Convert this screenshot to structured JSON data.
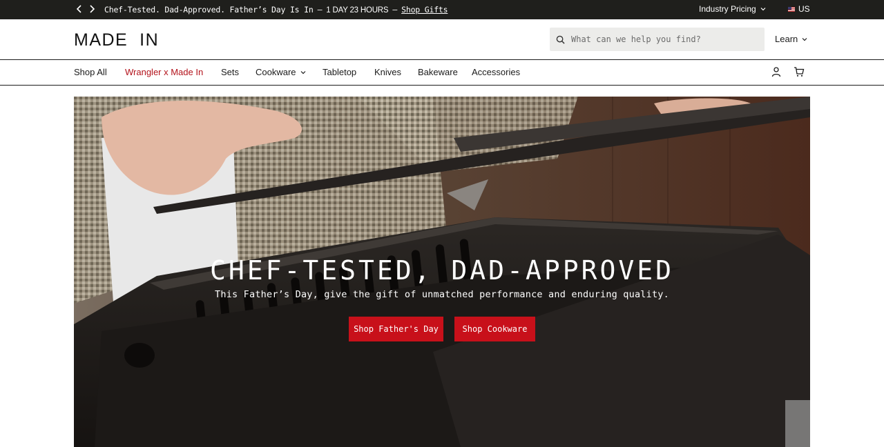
{
  "announcement": {
    "message": "Chef-Tested. Dad-Approved. Father’s Day Is In",
    "separator": "—",
    "countdown": "1 DAY 23 HOURS",
    "link_label": "Shop Gifts",
    "industry_pricing": "Industry Pricing",
    "locale": "US",
    "prev_icon": "chevron-left-icon",
    "next_icon": "chevron-right-icon"
  },
  "header": {
    "logo": "MADE  IN",
    "search_placeholder": "What can we help you find?",
    "learn_label": "Learn"
  },
  "nav": {
    "items": [
      {
        "label": "Shop All"
      },
      {
        "label": "Wrangler x Made In"
      },
      {
        "label": "Sets"
      },
      {
        "label": "Cookware"
      },
      {
        "label": "Tabletop"
      },
      {
        "label": "Knives"
      },
      {
        "label": "Bakeware"
      },
      {
        "label": "Accessories"
      }
    ],
    "account_icon": "user-icon",
    "cart_icon": "cart-icon"
  },
  "hero": {
    "title": "CHEF-TESTED, DAD-APPROVED",
    "subtitle": "This Father’s Day, give the gift of unmatched performance and enduring quality.",
    "primary_button": "Shop Father's Day",
    "secondary_button": "Shop Cookware"
  },
  "colors": {
    "announcement_bg": "#1f1f1c",
    "accent_red": "#c8101a",
    "nav_highlight": "#b3121b",
    "search_bg": "#ececea"
  }
}
